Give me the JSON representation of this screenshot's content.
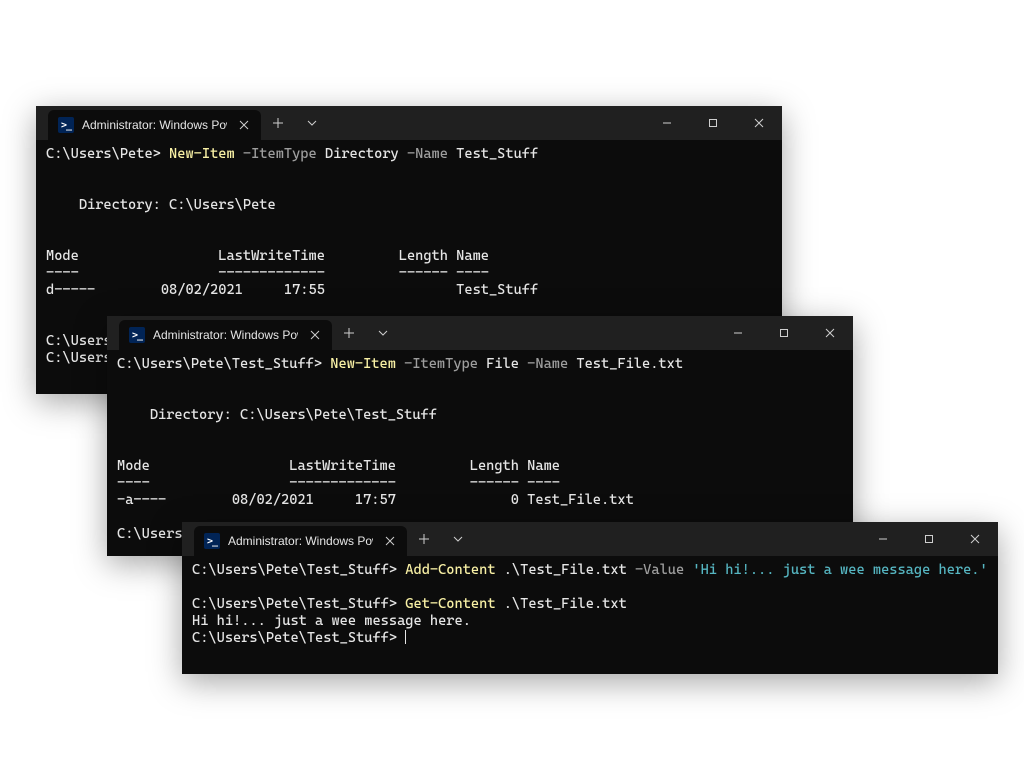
{
  "tab_title": "Administrator: Windows PowerShell",
  "windows": {
    "w1": {
      "prompt1": "C:\\Users\\Pete>",
      "cmd": " New-Item",
      "arg_itemtype": " -ItemType",
      "val_dir": " Directory",
      "arg_name": " -Name",
      "val_name": " Test_Stuff",
      "dirline": "    Directory: C:\\Users\\Pete",
      "hdr": "Mode                 LastWriteTime         Length Name",
      "hdr2": "----                 -------------         ------ ----",
      "row": "d-----        08/02/2021     17:55                Test_Stuff",
      "tail1": "C:\\Users",
      "tail2": "C:\\Users"
    },
    "w2": {
      "prompt1": "C:\\Users\\Pete\\Test_Stuff>",
      "cmd": " New-Item",
      "arg_itemtype": " -ItemType",
      "val_file": " File",
      "arg_name": " -Name",
      "val_name": " Test_File.txt",
      "dirline": "    Directory: C:\\Users\\Pete\\Test_Stuff",
      "hdr": "Mode                 LastWriteTime         Length Name",
      "hdr2": "----                 -------------         ------ ----",
      "row": "-a----        08/02/2021     17:57              0 Test_File.txt",
      "tail": "C:\\Users"
    },
    "w3": {
      "prompt": "C:\\Users\\Pete\\Test_Stuff>",
      "cmd_add": " Add-Content",
      "file": " .\\Test_File.txt",
      "arg_value": " -Value",
      "value_str": " 'Hi hi!... just a wee message here.'",
      "cmd_get": " Get-Content",
      "output": "Hi hi!... just a wee message here.",
      "prompt_end": "C:\\Users\\Pete\\Test_Stuff> "
    }
  }
}
